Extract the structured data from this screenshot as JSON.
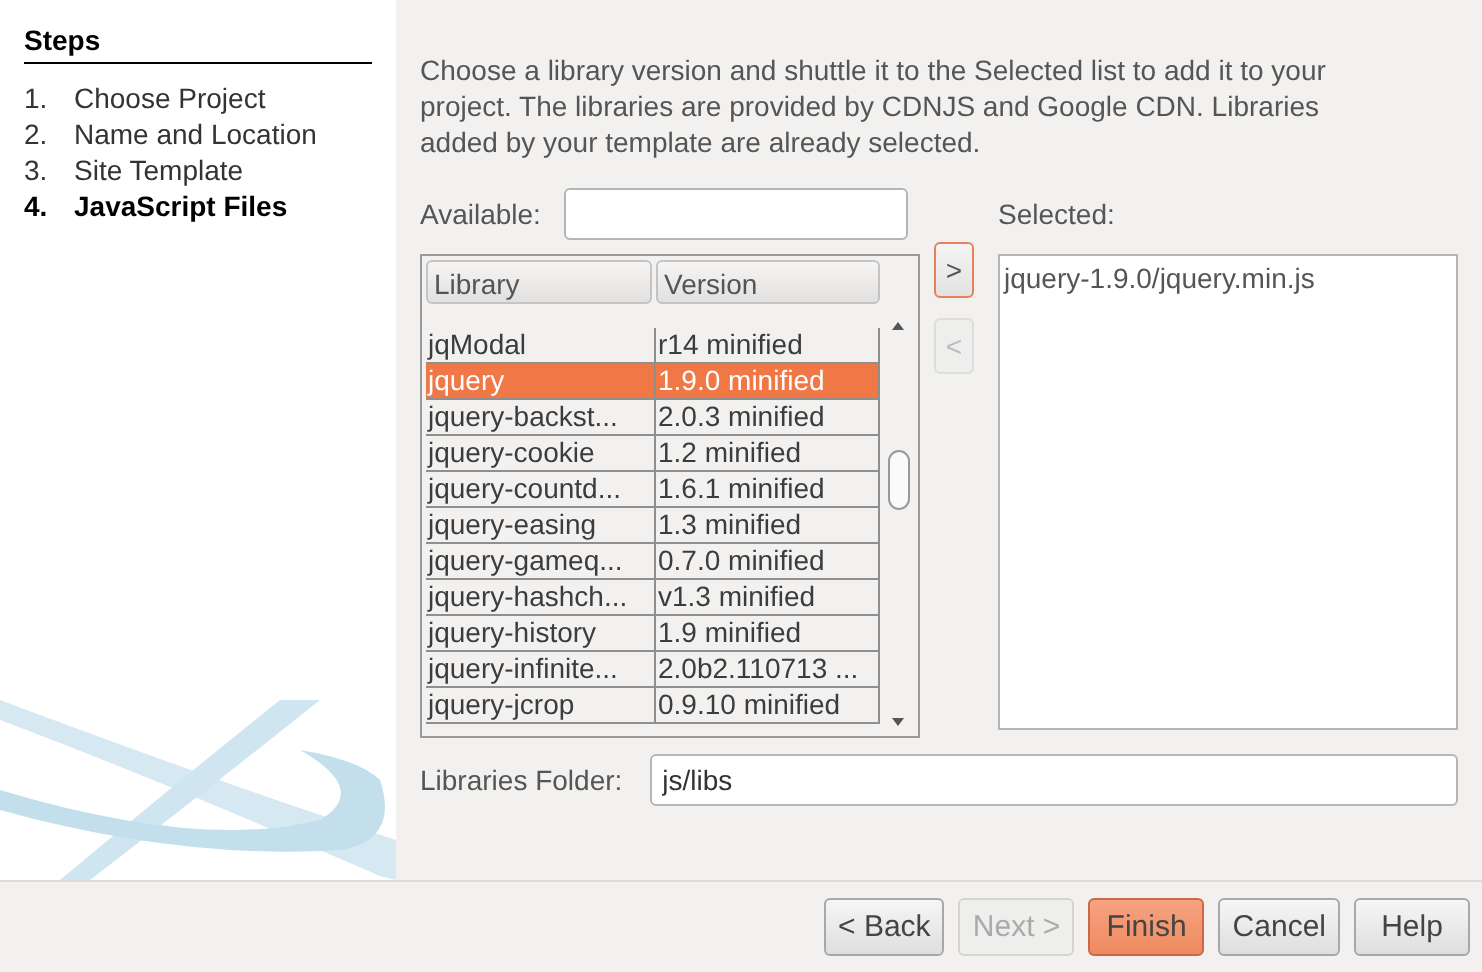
{
  "steps": {
    "title": "Steps",
    "items": [
      {
        "number": "1.",
        "label": "Choose Project",
        "selected": false
      },
      {
        "number": "2.",
        "label": "Name and Location",
        "selected": false
      },
      {
        "number": "3.",
        "label": "Site Template",
        "selected": false
      },
      {
        "number": "4.",
        "label": "JavaScript Files",
        "selected": true
      }
    ]
  },
  "description": "Choose a library version and shuttle it to the Selected list to add it to your project. The libraries are provided by CDNJS and Google CDN. Libraries added by your template are already selected.",
  "available": {
    "label": "Available:"
  },
  "table": {
    "columns": [
      "Library",
      "Version"
    ],
    "rows": [
      {
        "cells": [
          "jqModal",
          "r14 minified"
        ],
        "selected": false
      },
      {
        "cells": [
          "jquery",
          "1.9.0 minified"
        ],
        "selected": true
      },
      {
        "cells": [
          "jquery-backst...",
          "2.0.3 minified"
        ],
        "selected": false
      },
      {
        "cells": [
          "jquery-cookie",
          "1.2 minified"
        ],
        "selected": false
      },
      {
        "cells": [
          "jquery-countd...",
          "1.6.1 minified"
        ],
        "selected": false
      },
      {
        "cells": [
          "jquery-easing",
          "1.3 minified"
        ],
        "selected": false
      },
      {
        "cells": [
          "jquery-gameq...",
          "0.7.0 minified"
        ],
        "selected": false
      },
      {
        "cells": [
          "jquery-hashch...",
          "v1.3 minified"
        ],
        "selected": false
      },
      {
        "cells": [
          "jquery-history",
          "1.9 minified"
        ],
        "selected": false
      },
      {
        "cells": [
          "jquery-infinite...",
          "2.0b2.110713 ..."
        ],
        "selected": false
      },
      {
        "cells": [
          "jquery-jcrop",
          "0.9.10 minified"
        ],
        "selected": false
      }
    ]
  },
  "shuttle": [
    {
      "label": ">",
      "disabled": false
    },
    {
      "label": "<",
      "disabled": true
    }
  ],
  "selected": {
    "label": "Selected:",
    "items": [
      "jquery-1.9.0/jquery.min.js"
    ]
  },
  "folder": {
    "label": "Libraries Folder:",
    "value": "js/libs"
  },
  "buttons": [
    {
      "label": "< Back",
      "kind": "normal",
      "disabled": false
    },
    {
      "label": "Next >",
      "kind": "normal",
      "disabled": true
    },
    {
      "label": "Finish",
      "kind": "primary",
      "disabled": false
    },
    {
      "label": "Cancel",
      "kind": "normal",
      "disabled": false
    },
    {
      "label": "Help",
      "kind": "normal",
      "disabled": false
    }
  ]
}
